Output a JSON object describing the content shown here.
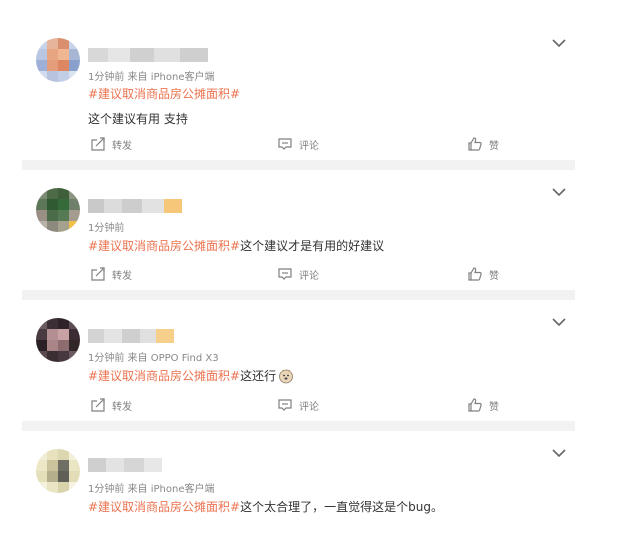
{
  "posts": [
    {
      "meta": "1分钟前  来自 iPhone客户端",
      "topic": "#建议取消商品房公摊面积#",
      "body": "这个建议有用 支持",
      "has_actions": true
    },
    {
      "meta": "1分钟前",
      "topic": "#建议取消商品房公摊面积#",
      "body": "这个建议才是有用的好建议",
      "has_actions": true
    },
    {
      "meta": "1分钟前  来自 OPPO Find X3",
      "topic": "#建议取消商品房公摊面积#",
      "body": "这还行",
      "emoji": "doge-emoji",
      "has_actions": true
    },
    {
      "meta": "1分钟前  来自 iPhone客户端",
      "topic": "#建议取消商品房公摊面积#",
      "body": "这个太合理了，一直觉得这是个bug。",
      "has_actions": false
    }
  ],
  "actions": {
    "repost_label": "转发",
    "comment_label": "评论",
    "like_label": "赞"
  },
  "colors": {
    "topic": "#eb7350",
    "meta": "#888888",
    "separator": "#f2f2f2"
  },
  "icons": [
    "chevron-down-icon",
    "repost-icon",
    "comment-icon",
    "like-icon",
    "doge-emoji"
  ]
}
